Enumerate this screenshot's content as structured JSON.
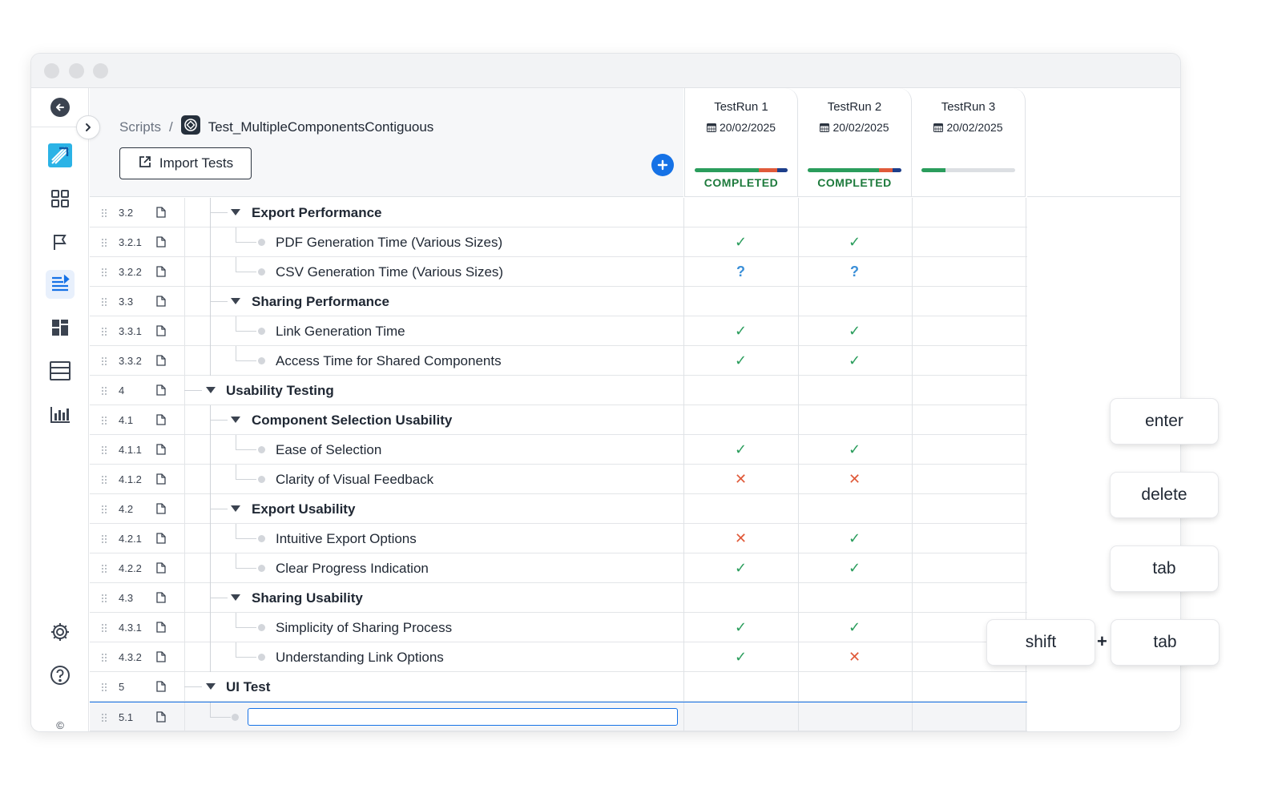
{
  "window": {
    "dots": 3
  },
  "sidenav": {
    "items": [
      {
        "icon": "back-arrow-icon"
      },
      {
        "icon": "app-logo-icon"
      },
      {
        "icon": "dashboard-grid-icon"
      },
      {
        "icon": "flag-icon"
      },
      {
        "icon": "scripts-list-icon",
        "active": true
      },
      {
        "icon": "widgets-icon"
      },
      {
        "icon": "table-layout-icon"
      },
      {
        "icon": "bar-chart-icon"
      },
      {
        "icon": "settings-gear-icon"
      },
      {
        "icon": "help-icon"
      },
      {
        "icon": "copyright-icon"
      }
    ],
    "copyright": "©"
  },
  "header": {
    "breadcrumb_root": "Scripts",
    "breadcrumb_sep": "/",
    "file_name": "Test_MultipleComponentsContiguous",
    "import_label": "Import Tests",
    "add_icon": "plus-icon"
  },
  "runs": [
    {
      "name": "TestRun 1",
      "date": "20/02/2025",
      "status": "COMPLETED",
      "progress": {
        "pass": 0.69,
        "fail": 0.2,
        "other": 0.11
      }
    },
    {
      "name": "TestRun 2",
      "date": "20/02/2025",
      "status": "COMPLETED",
      "progress": {
        "pass": 0.76,
        "fail": 0.15,
        "other": 0.09
      }
    },
    {
      "name": "TestRun 3",
      "date": "20/02/2025",
      "status": "",
      "progress": {
        "pass": 0.26,
        "fail": 0,
        "other": 0
      }
    }
  ],
  "colors": {
    "accent": "#1672e6",
    "pass": "#2a9d5c",
    "fail": "#e05a3a",
    "unknown": "#3a8fd8",
    "status_text": "#1d7a3c"
  },
  "rows": [
    {
      "num": "3.2",
      "title": "Export Performance",
      "level": 1,
      "group": true,
      "r1": "",
      "r2": ""
    },
    {
      "num": "3.2.1",
      "title": "PDF Generation Time (Various Sizes)",
      "level": 2,
      "group": false,
      "r1": "✓",
      "r2": "✓"
    },
    {
      "num": "3.2.2",
      "title": "CSV Generation Time (Various Sizes)",
      "level": 2,
      "group": false,
      "r1": "?",
      "r2": "?"
    },
    {
      "num": "3.3",
      "title": "Sharing Performance",
      "level": 1,
      "group": true,
      "r1": "",
      "r2": ""
    },
    {
      "num": "3.3.1",
      "title": "Link Generation Time",
      "level": 2,
      "group": false,
      "r1": "✓",
      "r2": "✓"
    },
    {
      "num": "3.3.2",
      "title": "Access Time for Shared Components",
      "level": 2,
      "group": false,
      "r1": "✓",
      "r2": "✓"
    },
    {
      "num": "4",
      "title": "Usability Testing",
      "level": 0,
      "group": true,
      "r1": "",
      "r2": ""
    },
    {
      "num": "4.1",
      "title": "Component Selection Usability",
      "level": 1,
      "group": true,
      "r1": "",
      "r2": ""
    },
    {
      "num": "4.1.1",
      "title": "Ease of Selection",
      "level": 2,
      "group": false,
      "r1": "✓",
      "r2": "✓"
    },
    {
      "num": "4.1.2",
      "title": "Clarity of Visual Feedback",
      "level": 2,
      "group": false,
      "r1": "✕",
      "r2": "✕"
    },
    {
      "num": "4.2",
      "title": "Export Usability",
      "level": 1,
      "group": true,
      "r1": "",
      "r2": ""
    },
    {
      "num": "4.2.1",
      "title": "Intuitive Export Options",
      "level": 2,
      "group": false,
      "r1": "✕",
      "r2": "✓"
    },
    {
      "num": "4.2.2",
      "title": "Clear Progress Indication",
      "level": 2,
      "group": false,
      "r1": "✓",
      "r2": "✓"
    },
    {
      "num": "4.3",
      "title": "Sharing Usability",
      "level": 1,
      "group": true,
      "r1": "",
      "r2": ""
    },
    {
      "num": "4.3.1",
      "title": "Simplicity of Sharing Process",
      "level": 2,
      "group": false,
      "r1": "✓",
      "r2": "✓"
    },
    {
      "num": "4.3.2",
      "title": "Understanding Link Options",
      "level": 2,
      "group": false,
      "r1": "✓",
      "r2": "✕"
    },
    {
      "num": "5",
      "title": "UI Test",
      "level": 0,
      "group": true,
      "r1": "",
      "r2": ""
    }
  ],
  "new_row": {
    "num": "5.1",
    "value": "",
    "placeholder": ""
  },
  "keys": {
    "enter": "enter",
    "delete": "delete",
    "tab": "tab",
    "shift": "shift",
    "plus": "+",
    "tab2": "tab"
  }
}
